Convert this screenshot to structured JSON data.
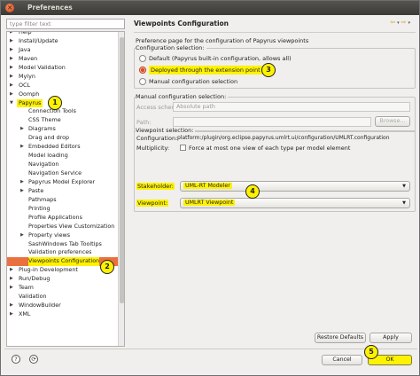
{
  "window": {
    "title": "Preferences"
  },
  "filter": {
    "placeholder": "type filter text"
  },
  "tree": [
    {
      "label": "Help",
      "level": 0,
      "arrow": "▶"
    },
    {
      "label": "Install/Update",
      "level": 0,
      "arrow": "▶"
    },
    {
      "label": "Java",
      "level": 0,
      "arrow": "▶"
    },
    {
      "label": "Maven",
      "level": 0,
      "arrow": "▶"
    },
    {
      "label": "Model Validation",
      "level": 0,
      "arrow": "▶"
    },
    {
      "label": "Mylyn",
      "level": 0,
      "arrow": "▶"
    },
    {
      "label": "OCL",
      "level": 0,
      "arrow": "▶"
    },
    {
      "label": "Oomph",
      "level": 0,
      "arrow": "▶"
    },
    {
      "label": "Papyrus",
      "level": 0,
      "arrow": "▼",
      "highlight": true
    },
    {
      "label": "Connection Tools",
      "level": 1,
      "arrow": ""
    },
    {
      "label": "CSS Theme",
      "level": 1,
      "arrow": ""
    },
    {
      "label": "Diagrams",
      "level": 1,
      "arrow": "▶"
    },
    {
      "label": "Drag and drop",
      "level": 1,
      "arrow": ""
    },
    {
      "label": "Embedded Editors",
      "level": 1,
      "arrow": "▶"
    },
    {
      "label": "Model loading",
      "level": 1,
      "arrow": ""
    },
    {
      "label": "Navigation",
      "level": 1,
      "arrow": ""
    },
    {
      "label": "Navigation Service",
      "level": 1,
      "arrow": ""
    },
    {
      "label": "Papyrus Model Explorer",
      "level": 1,
      "arrow": "▶"
    },
    {
      "label": "Paste",
      "level": 1,
      "arrow": "▶"
    },
    {
      "label": "Pathmaps",
      "level": 1,
      "arrow": ""
    },
    {
      "label": "Printing",
      "level": 1,
      "arrow": ""
    },
    {
      "label": "Profile Applications",
      "level": 1,
      "arrow": ""
    },
    {
      "label": "Properties View Customization",
      "level": 1,
      "arrow": ""
    },
    {
      "label": "Property views",
      "level": 1,
      "arrow": "▶"
    },
    {
      "label": "SashWindows Tab Tooltips",
      "level": 1,
      "arrow": ""
    },
    {
      "label": "Validation preferences",
      "level": 1,
      "arrow": ""
    },
    {
      "label": "Viewpoints Configuration",
      "level": 1,
      "arrow": "",
      "selected": true
    },
    {
      "label": "Plug-in Development",
      "level": 0,
      "arrow": "▶"
    },
    {
      "label": "Run/Debug",
      "level": 0,
      "arrow": "▶"
    },
    {
      "label": "Team",
      "level": 0,
      "arrow": "▶"
    },
    {
      "label": "Validation",
      "level": 0,
      "arrow": ""
    },
    {
      "label": "WindowBuilder",
      "level": 0,
      "arrow": "▶"
    },
    {
      "label": "XML",
      "level": 0,
      "arrow": "▶"
    }
  ],
  "page": {
    "title": "Viewpoints Configuration",
    "description": "Preference page for the configuration of Papyrus viewpoints",
    "config_selection": {
      "label": "Configuration selection:",
      "options": [
        "Default (Papyrus built-in configuration, allows all)",
        "Deployed through the extension point",
        "Manual configuration selection"
      ],
      "selected_index": 1
    },
    "manual": {
      "label": "Manual configuration selection:",
      "access_label": "Access scheme:",
      "access_value": "Absolute path",
      "path_label": "Path:",
      "path_value": "",
      "browse_label": "Browse..."
    },
    "viewpoint": {
      "label": "Viewpoint selection:",
      "configuration_label": "Configuration:",
      "configuration_value": "platform:/plugin/org.eclipse.papyrus.umlrt.ui/configuration/UMLRT.configuration",
      "multiplicity_label": "Multiplicity:",
      "multiplicity_text": "Force at most one view of each type per model element",
      "stakeholder_label": "Stakeholder:",
      "stakeholder_value": "UML-RT Modeler",
      "viewpoint_label": "Viewpoint:",
      "viewpoint_value": "UMLRT Viewpoint"
    },
    "restore_label": "Restore Defaults",
    "apply_label": "Apply"
  },
  "footer": {
    "cancel_label": "Cancel",
    "ok_label": "OK"
  },
  "badges": [
    "1",
    "2",
    "3",
    "4",
    "5"
  ],
  "colors": {
    "highlight": "#fff200",
    "selection": "#e9713f",
    "titlebar": "#3b3a36",
    "radio_on": "#e04b22"
  },
  "nav_icons": [
    "back-icon",
    "back-menu-icon",
    "forward-icon",
    "forward-menu-icon"
  ]
}
